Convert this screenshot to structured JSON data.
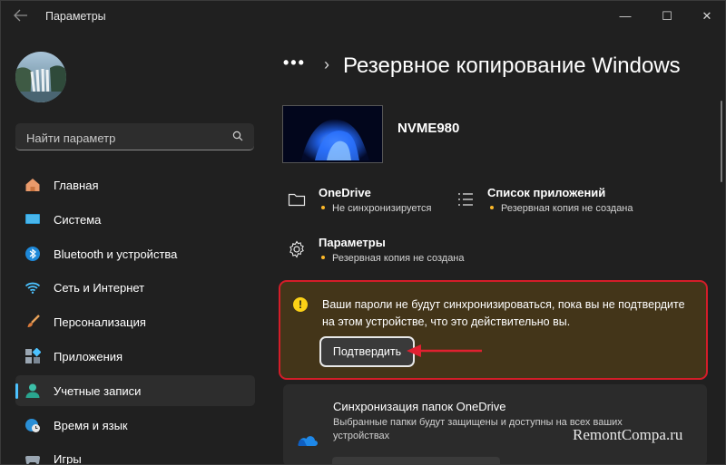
{
  "window": {
    "title": "Параметры",
    "controls": {
      "minimize": "—",
      "maximize": "☐",
      "close": "✕"
    },
    "back_icon": "arrow-left-icon"
  },
  "search": {
    "placeholder": "Найти параметр",
    "value": ""
  },
  "sidebar": {
    "items": [
      {
        "label": "Главная",
        "icon": "home-icon"
      },
      {
        "label": "Система",
        "icon": "system-icon"
      },
      {
        "label": "Bluetooth и устройства",
        "icon": "bluetooth-icon"
      },
      {
        "label": "Сеть и Интернет",
        "icon": "wifi-icon"
      },
      {
        "label": "Персонализация",
        "icon": "brush-icon"
      },
      {
        "label": "Приложения",
        "icon": "apps-icon"
      },
      {
        "label": "Учетные записи",
        "icon": "account-icon",
        "selected": true
      },
      {
        "label": "Время и язык",
        "icon": "clock-globe-icon"
      },
      {
        "label": "Игры",
        "icon": "gamepad-icon"
      }
    ]
  },
  "header": {
    "breadcrumb_more": "•••",
    "separator": "›",
    "title": "Резервное копирование Windows"
  },
  "device": {
    "name": "NVME980"
  },
  "info": {
    "onedrive": {
      "title": "OneDrive",
      "status": "Не синхронизируется"
    },
    "app_list": {
      "title": "Список приложений",
      "status": "Резервная копия не создана"
    },
    "settings": {
      "title": "Параметры",
      "status": "Резервная копия не создана"
    }
  },
  "warning": {
    "message": "Ваши пароли не будут синхронизироваться, пока вы не подтвердите на этом устройстве, что это действительно вы.",
    "button": "Подтвердить"
  },
  "sync": {
    "title": "Синхронизация папок OneDrive",
    "description": "Выбранные папки будут защищены и доступны на всех ваших устройствах"
  },
  "watermark": "RemontCompa.ru",
  "colors": {
    "background": "#202020",
    "accent": "#4cc2ff",
    "warning_bg": "#433519",
    "highlight_red": "#d41d29",
    "status_dot": "#fcb829"
  }
}
